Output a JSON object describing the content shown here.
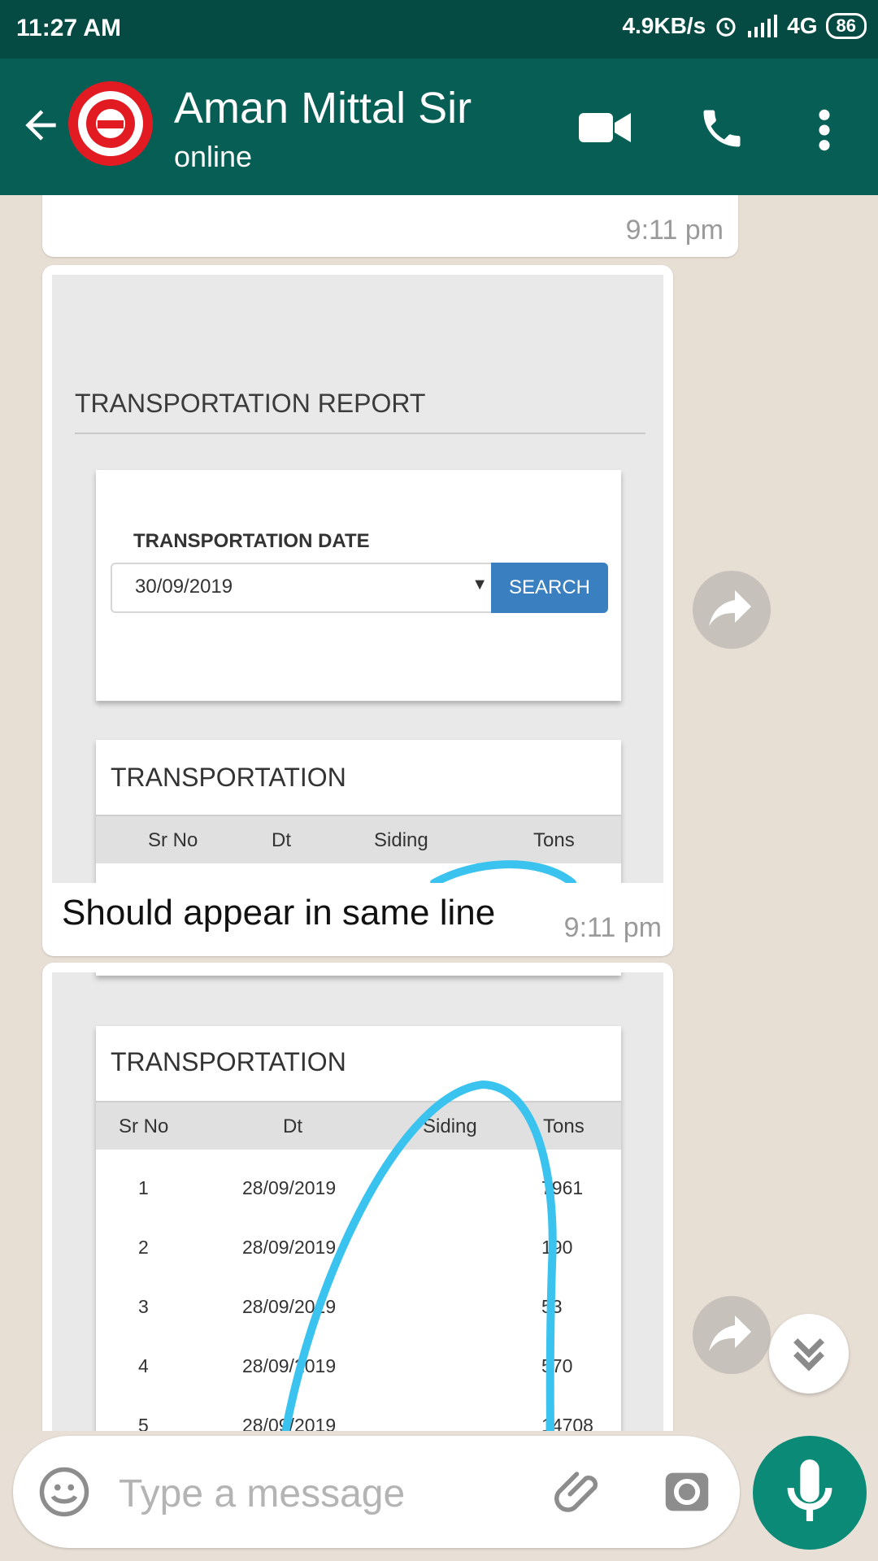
{
  "status_bar": {
    "time": "11:27 AM",
    "speed": "4.9KB/s",
    "network": "4G",
    "battery": "86"
  },
  "header": {
    "contact_name": "Aman Mittal Sir",
    "status": "online",
    "icons": [
      "back-arrow-icon",
      "avatar",
      "video-call-icon",
      "phone-icon",
      "more-icon"
    ]
  },
  "messages": {
    "first_time": "9:11 pm",
    "image1": {
      "report_title": "TRANSPORTATION REPORT",
      "date_label": "TRANSPORTATION DATE",
      "date_value": "30/09/2019",
      "search_button": "SEARCH",
      "table_title": "TRANSPORTATION",
      "columns": [
        "Sr No",
        "Dt",
        "Siding",
        "Tons"
      ],
      "caption": "Should appear in same line",
      "time": "9:11 pm"
    },
    "image2": {
      "table_title": "TRANSPORTATION",
      "columns": [
        "Sr No",
        "Dt",
        "Siding",
        "Tons"
      ],
      "rows": [
        {
          "sr": "1",
          "dt": "28/09/2019",
          "tons": "7961"
        },
        {
          "sr": "2",
          "dt": "28/09/2019",
          "tons": "190"
        },
        {
          "sr": "3",
          "dt": "28/09/2019",
          "tons": "53"
        },
        {
          "sr": "4",
          "dt": "28/09/2019",
          "tons": "570"
        },
        {
          "sr": "5",
          "dt": "28/09/2019",
          "tons": "14708"
        }
      ]
    }
  },
  "composer": {
    "placeholder": "Type a message"
  },
  "colors": {
    "header": "#075e54",
    "statusbar": "#054b43",
    "accent": "#0a8a77",
    "search_button": "#3a7fc0",
    "scribble": "#3bc3f0"
  }
}
